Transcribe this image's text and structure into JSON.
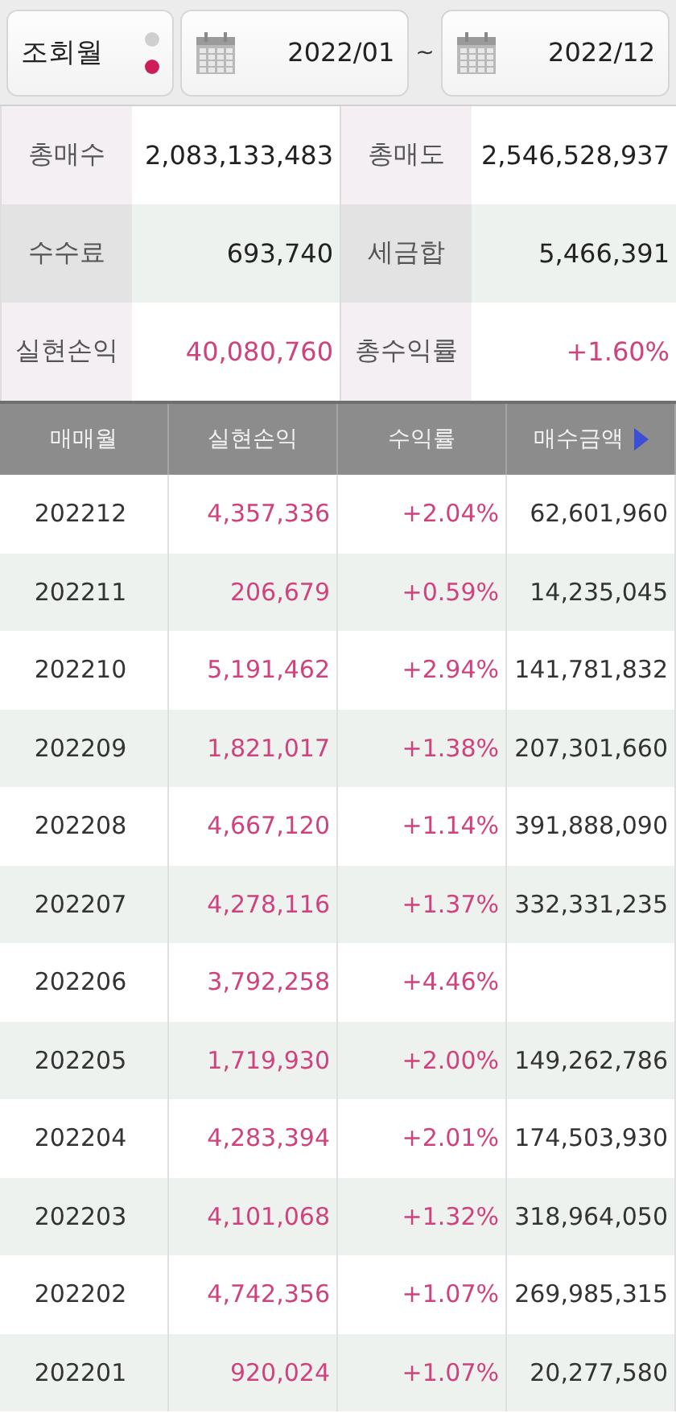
{
  "filter": {
    "mode_label": "조회월",
    "mode_dots": [
      {
        "selected": false
      },
      {
        "selected": true
      }
    ],
    "start_date": "2022/01",
    "separator": "~",
    "end_date": "2022/12"
  },
  "summary": [
    {
      "label": "총매수",
      "value": "2,083,133,483",
      "kind": "plain"
    },
    {
      "label": "총매도",
      "value": "2,546,528,937",
      "kind": "plain"
    },
    {
      "label": "수수료",
      "value": "693,740",
      "kind": "plain"
    },
    {
      "label": "세금합",
      "value": "5,466,391",
      "kind": "plain"
    },
    {
      "label": "실현손익",
      "value": "40,080,760",
      "kind": "gain"
    },
    {
      "label": "총수익률",
      "value": "+1.60%",
      "kind": "gain"
    }
  ],
  "table": {
    "columns": [
      "매매월",
      "실현손익",
      "수익률",
      "매수금액"
    ],
    "rows": [
      {
        "month": "202212",
        "profit": "4,357,336",
        "rate": "+2.04%",
        "buy_amount": "62,601,960"
      },
      {
        "month": "202211",
        "profit": "206,679",
        "rate": "+0.59%",
        "buy_amount": "14,235,045"
      },
      {
        "month": "202210",
        "profit": "5,191,462",
        "rate": "+2.94%",
        "buy_amount": "141,781,832"
      },
      {
        "month": "202209",
        "profit": "1,821,017",
        "rate": "+1.38%",
        "buy_amount": "207,301,660"
      },
      {
        "month": "202208",
        "profit": "4,667,120",
        "rate": "+1.14%",
        "buy_amount": "391,888,090"
      },
      {
        "month": "202207",
        "profit": "4,278,116",
        "rate": "+1.37%",
        "buy_amount": "332,331,235"
      },
      {
        "month": "202206",
        "profit": "3,792,258",
        "rate": "+4.46%"
      },
      {
        "month": "202205",
        "profit": "1,719,930",
        "rate": "+2.00%",
        "buy_amount": "149,262,786"
      },
      {
        "month": "202204",
        "profit": "4,283,394",
        "rate": "+2.01%",
        "buy_amount": "174,503,930"
      },
      {
        "month": "202203",
        "profit": "4,101,068",
        "rate": "+1.32%",
        "buy_amount": "318,964,050"
      },
      {
        "month": "202202",
        "profit": "4,742,356",
        "rate": "+1.07%",
        "buy_amount": "269,985,315"
      },
      {
        "month": "202201",
        "profit": "920,024",
        "rate": "+1.07%",
        "buy_amount": "20,277,580"
      }
    ]
  }
}
